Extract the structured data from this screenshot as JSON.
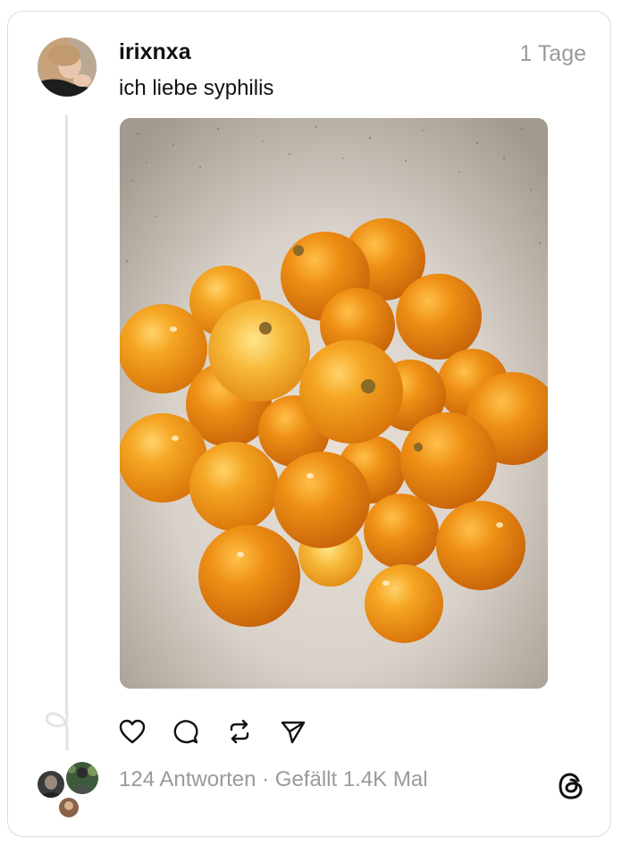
{
  "post": {
    "username": "irixnxa",
    "time": "1 Tage",
    "text": "ich liebe syphilis"
  },
  "actions": {
    "like_icon": "heart-icon",
    "reply_icon": "comment-icon",
    "repost_icon": "repost-icon",
    "share_icon": "send-icon"
  },
  "stats": {
    "replies": "124 Antworten",
    "separator": " · ",
    "likes": "Gefällt 1.4K Mal"
  },
  "brand": {
    "logo": "threads-logo-icon"
  },
  "colors": {
    "text": "#111111",
    "muted": "#9a9a9a",
    "border": "#dcdcdc",
    "fruit": "#f09a16"
  }
}
